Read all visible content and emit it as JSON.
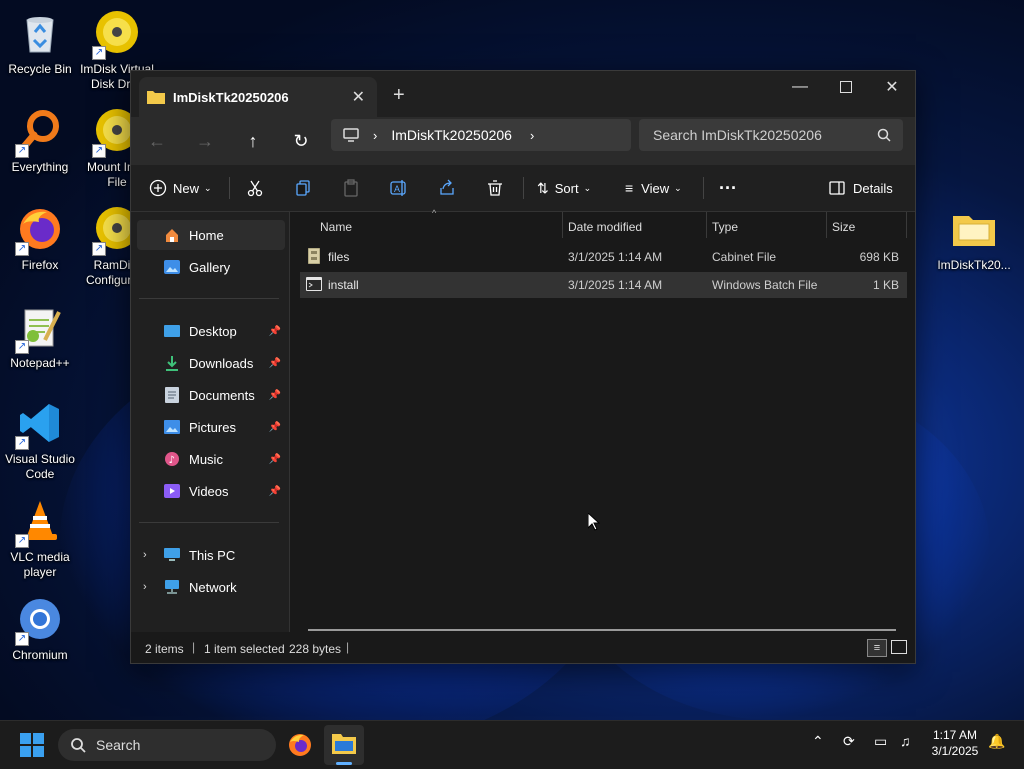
{
  "desktop": {
    "icons": [
      {
        "label": "Recycle Bin"
      },
      {
        "label": "ImDisk Virtual Disk Dri..."
      },
      {
        "label": "Everything"
      },
      {
        "label": "Mount Im... File"
      },
      {
        "label": "Firefox"
      },
      {
        "label": "RamDi... Configura..."
      },
      {
        "label": "Notepad++"
      },
      {
        "label": "Visual Studio Code"
      },
      {
        "label": "VLC media player"
      },
      {
        "label": "Chromium"
      },
      {
        "label": "ImDiskTk20..."
      }
    ]
  },
  "window": {
    "tab_title": "ImDiskTk20250206",
    "address_crumb": "ImDiskTk20250206",
    "search_placeholder": "Search ImDiskTk20250206",
    "toolbar": {
      "new_label": "New",
      "sort_label": "Sort",
      "view_label": "View",
      "details_label": "Details"
    },
    "sidebar": {
      "home": "Home",
      "gallery": "Gallery",
      "quick_access": [
        {
          "label": "Desktop"
        },
        {
          "label": "Downloads"
        },
        {
          "label": "Documents"
        },
        {
          "label": "Pictures"
        },
        {
          "label": "Music"
        },
        {
          "label": "Videos"
        }
      ],
      "this_pc": "This PC",
      "network": "Network"
    },
    "columns": {
      "name": "Name",
      "date": "Date modified",
      "type": "Type",
      "size": "Size"
    },
    "files": [
      {
        "name": "files",
        "date": "3/1/2025 1:14 AM",
        "type": "Cabinet File",
        "size": "698 KB"
      },
      {
        "name": "install",
        "date": "3/1/2025 1:14 AM",
        "type": "Windows Batch File",
        "size": "1 KB"
      }
    ],
    "status": {
      "count": "2 items",
      "selection": "1 item selected",
      "bytes": "228 bytes"
    }
  },
  "taskbar": {
    "search_label": "Search",
    "time": "1:17 AM",
    "date": "3/1/2025"
  }
}
